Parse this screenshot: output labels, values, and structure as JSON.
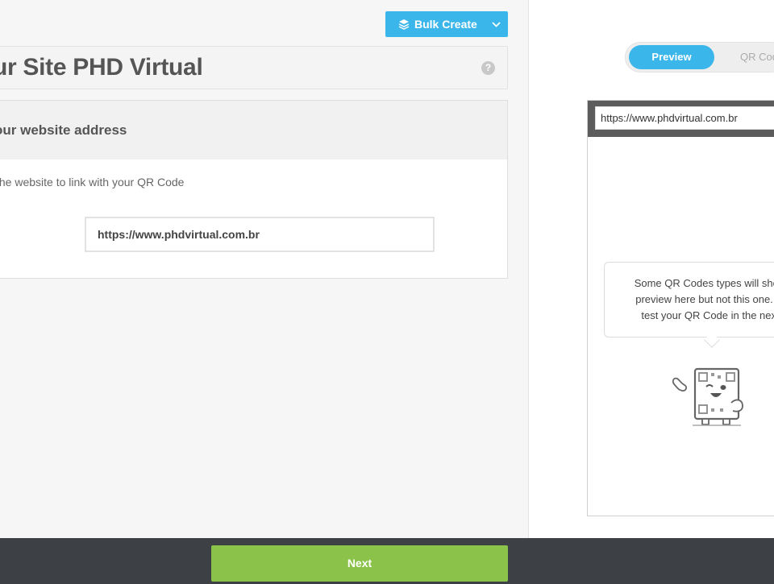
{
  "toolbar": {
    "bulk_create_label": "Bulk Create"
  },
  "header": {
    "title": "ur Site PHD Virtual"
  },
  "help": {
    "icon_text": "?"
  },
  "section": {
    "heading": "our website address",
    "description": "the website to link with your QR Code",
    "field_label": ":",
    "url_value": "https://www.phdvirtual.com.br"
  },
  "preview_toggle": {
    "active_label": "Preview",
    "inactive_label": "QR Cod"
  },
  "phone": {
    "address_bar": "https://www.phdvirtual.com.br",
    "bubble_lines": [
      "Some QR Codes types will show",
      "preview here but not this one. Vi",
      "test your QR Code in the next"
    ]
  },
  "footer": {
    "next_label": "Next"
  },
  "colors": {
    "accent": "#3ab6ea",
    "next": "#8bc34a",
    "footer_bg": "#3d4145"
  }
}
